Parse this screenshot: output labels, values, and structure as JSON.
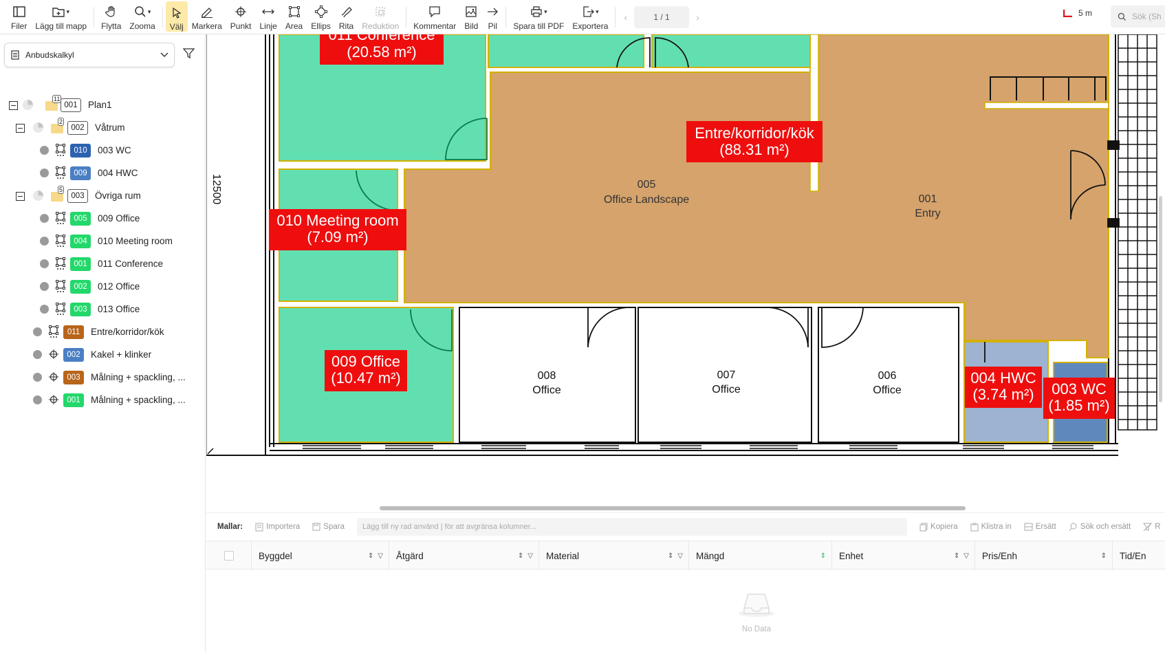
{
  "toolbar": {
    "files": "Filer",
    "add_map": "Lägg till mapp",
    "move": "Flytta",
    "zoom": "Zooma",
    "select": "Välj",
    "mark": "Markera",
    "point": "Punkt",
    "line": "Linje",
    "area": "Area",
    "ellipse": "Ellips",
    "draw": "Rita",
    "reduction": "Reduktion",
    "comment": "Kommentar",
    "image": "Bild",
    "arrow": "Pil",
    "save_pdf": "Spara till PDF",
    "export": "Exportera",
    "page": "1 / 1",
    "scale": "5 m",
    "search_placeholder": "Sök (Sh"
  },
  "left_panel": {
    "dropdown_value": "Anbudskalkyl",
    "tree": [
      {
        "code": "001",
        "label": "Plan1",
        "count": "11"
      },
      {
        "code": "002",
        "label": "Våtrum",
        "count": "2"
      },
      {
        "code": "010",
        "label": "003 WC"
      },
      {
        "code": "009",
        "label": "004 HWC"
      },
      {
        "code": "003",
        "label": "Övriga rum",
        "count": "5"
      },
      {
        "code": "005",
        "label": "009 Office"
      },
      {
        "code": "004",
        "label": "010 Meeting room"
      },
      {
        "code": "001",
        "label": "011 Conference"
      },
      {
        "code": "002",
        "label": "012 Office"
      },
      {
        "code": "003",
        "label": "013 Office"
      },
      {
        "code": "011",
        "label": "Entre/korridor/kök"
      },
      {
        "code": "002",
        "label": "Kakel + klinker"
      },
      {
        "code": "003",
        "label": "Målning + spackling, ..."
      },
      {
        "code": "001",
        "label": "Målning + spackling, ..."
      }
    ]
  },
  "plan": {
    "dimension": "12500",
    "rooms": [
      {
        "num": "005",
        "name": "Office Landscape"
      },
      {
        "num": "001",
        "name": "Entry"
      },
      {
        "num": "008",
        "name": "Office"
      },
      {
        "num": "007",
        "name": "Office"
      },
      {
        "num": "006",
        "name": "Office"
      }
    ],
    "labels": [
      {
        "title": "011 Conference",
        "area": "(20.58 m²)"
      },
      {
        "title": "Entre/korridor/kök",
        "area": "(88.31 m²)"
      },
      {
        "title": "010 Meeting room",
        "area": "(7.09 m²)"
      },
      {
        "title": "009 Office",
        "area": "(10.47 m²)"
      },
      {
        "title": "004 HWC",
        "area": "(3.74 m²)"
      },
      {
        "title": "003 WC",
        "area": "(1.85 m²)"
      }
    ]
  },
  "bottom": {
    "mallar": "Mallar:",
    "import": "Importera",
    "save": "Spara",
    "filter_placeholder": "Lägg till ny rad använd | för att avgränsa kolumner...",
    "copy": "Kopiera",
    "paste": "Klistra in",
    "replace": "Ersätt",
    "find_replace": "Sök och ersätt",
    "r": "R",
    "columns": [
      "Byggdel",
      "Åtgärd",
      "Material",
      "Mängd",
      "Enhet",
      "Pris/Enh",
      "Tid/En"
    ],
    "no_data": "No Data"
  },
  "colors": {
    "green_room": "#62dfb1",
    "tan_room": "#d5a36b",
    "blue_room": "#9db3d1",
    "label_red": "#ee0e0e"
  }
}
